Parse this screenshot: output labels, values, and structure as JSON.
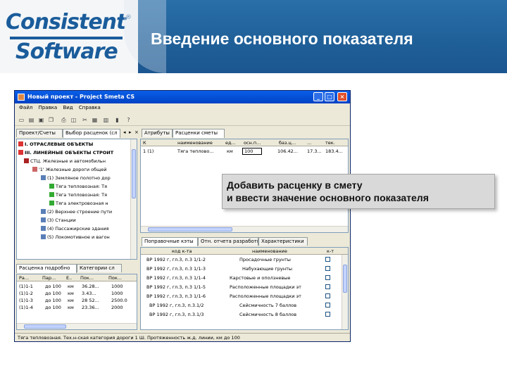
{
  "slide": {
    "logo_line1": "Consistent",
    "logo_line2": "Software",
    "logo_reg": "®",
    "title": "Введение основного показателя"
  },
  "window": {
    "title": "Новый проект - Project Smeta CS",
    "btn_min": "_",
    "btn_max": "□",
    "btn_close": "×",
    "menu": [
      "Файл",
      "Правка",
      "Вид",
      "Справка"
    ]
  },
  "left_tabs": [
    "Проект/Счеты",
    "Выбор расценок (сл"
  ],
  "tree": [
    "I. ОТРАСЛЕВЫЕ ОБЪЕКТЫ",
    "III. ЛИНЕЙНЫЕ ОБЪЕКТЫ СТРОИТ",
    "СТЦ. Железные и автомобильн",
    "'1' Железные дороги общей",
    "(1) Земляное полотно дор",
    "Тяга тепловозная: Тя",
    "Тяга тепловозная: Тя",
    "Тяга электровозная н",
    "(2) Верхнее строение пути",
    "(3) Станции",
    "(4) Пассажирские здания",
    "(5) Локомотивное и вагон"
  ],
  "right_tabs": [
    "Атрибуты",
    "Расценки сметы"
  ],
  "estimate_grid": {
    "headers": [
      "К",
      "наименование",
      "ед...",
      "осн.п...",
      "баз.ц...",
      "...",
      "тек."
    ],
    "row": {
      "code": "1 (1)",
      "name": "Тяга теплово...",
      "unit": "км",
      "value": "100",
      "base": "106.42...",
      "k": "17.3...",
      "cur": "183.4..."
    }
  },
  "callout": {
    "line1": "Добавить расценку в смету",
    "line2": "и ввести значение основного показателя"
  },
  "bottom_tabs": [
    "Поправочные кэты",
    "Отн. отчета разработки",
    "Характеристики"
  ],
  "coeff_grid": {
    "headers": [
      "код к-та",
      "наименование",
      "к-т"
    ],
    "rows": [
      [
        "ВР 1992 г, гл.3, п.3 1/1-2",
        "Просадочные грунты",
        false
      ],
      [
        "ВР 1992 г, гл.3, п.3 1/1-3",
        "Набухающие грунты",
        false
      ],
      [
        "ВР 1992 г, гл.3, п.3 1/1-4",
        "Карстовые и оползневые",
        false
      ],
      [
        "ВР 1992 г, гл.3, п.3 1/1-5",
        "Расположенные площадки эт",
        false
      ],
      [
        "ВР 1992 г, гл.3, п.3 1/1-6",
        "Расположенные площадки эт",
        false
      ],
      [
        "ВР 1992 г, гл.3, п.3.1/2",
        "Сейсмичность 7 баллов",
        false
      ],
      [
        "ВР 1992 г, гл.3, п.3.1/3",
        "Сейсмичность 8 баллов",
        false
      ]
    ]
  },
  "lower_left_tabs": [
    "Расценка подробно",
    "Категории сл"
  ],
  "param_grid": {
    "headers": [
      "Ра...",
      "Пар...",
      "Е..",
      "Пок...",
      "Пок..."
    ],
    "rows": [
      [
        "(1)1-1",
        "до 100",
        "км",
        "36.28...",
        "1000"
      ],
      [
        "(1)1-2",
        "до 100",
        "км",
        "3.43...",
        "1000"
      ],
      [
        "(1)1-3",
        "до 100",
        "км",
        "28 52...",
        "2500.0"
      ],
      [
        "(1)1-4",
        "до 100",
        "км",
        "23.36...",
        "2000"
      ]
    ]
  },
  "statusbar": "Тяга тепловозная. Тех.н-ская категория дороги 1 Ш. Протяженность ж.д. линии, км до 100"
}
